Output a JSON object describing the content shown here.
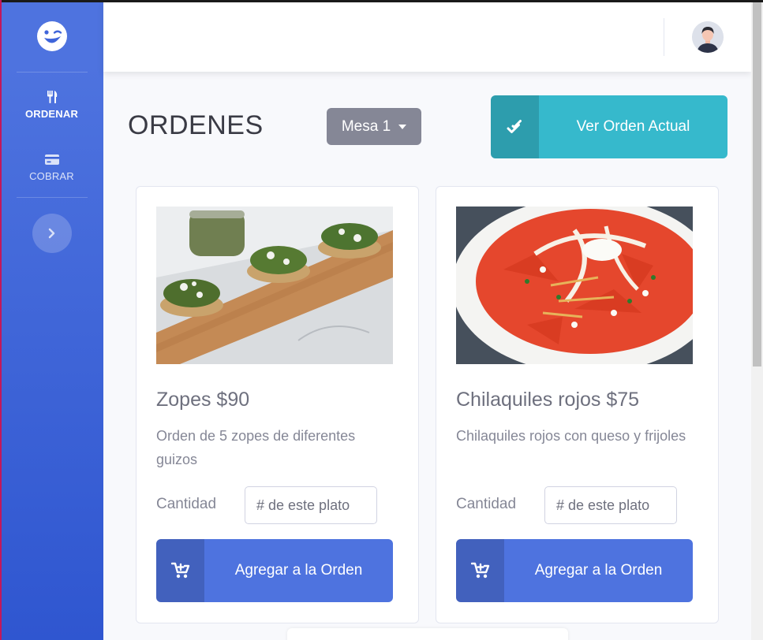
{
  "sidebar": {
    "brand_icon": "winking-face-logo",
    "items": [
      {
        "label": "ORDENAR",
        "icon": "utensils-icon",
        "active": true
      },
      {
        "label": "COBRAR",
        "icon": "credit-card-icon",
        "active": false
      }
    ],
    "toggle_icon": "chevron-right-icon"
  },
  "topbar": {
    "avatar_icon": "user-avatar"
  },
  "main": {
    "title": "ORDENES",
    "table_select": {
      "value": "Mesa 1"
    },
    "view_order_button": {
      "label": "Ver Orden Actual",
      "icon": "double-check-icon"
    },
    "products": [
      {
        "name": "Zopes $90",
        "description": "Orden de 5 zopes de diferentes guizos",
        "quantity_label": "Cantidad",
        "quantity_placeholder": "# de este plato",
        "add_button": "Agregar a la Orden"
      },
      {
        "name": "Chilaquiles rojos $75",
        "description": "Chilaquiles rojos con queso y frijoles",
        "quantity_label": "Cantidad",
        "quantity_placeholder": "# de este plato",
        "add_button": "Agregar a la Orden"
      }
    ]
  },
  "colors": {
    "primary": "#4e73df",
    "info": "#36b9cc",
    "secondary": "#858796"
  }
}
